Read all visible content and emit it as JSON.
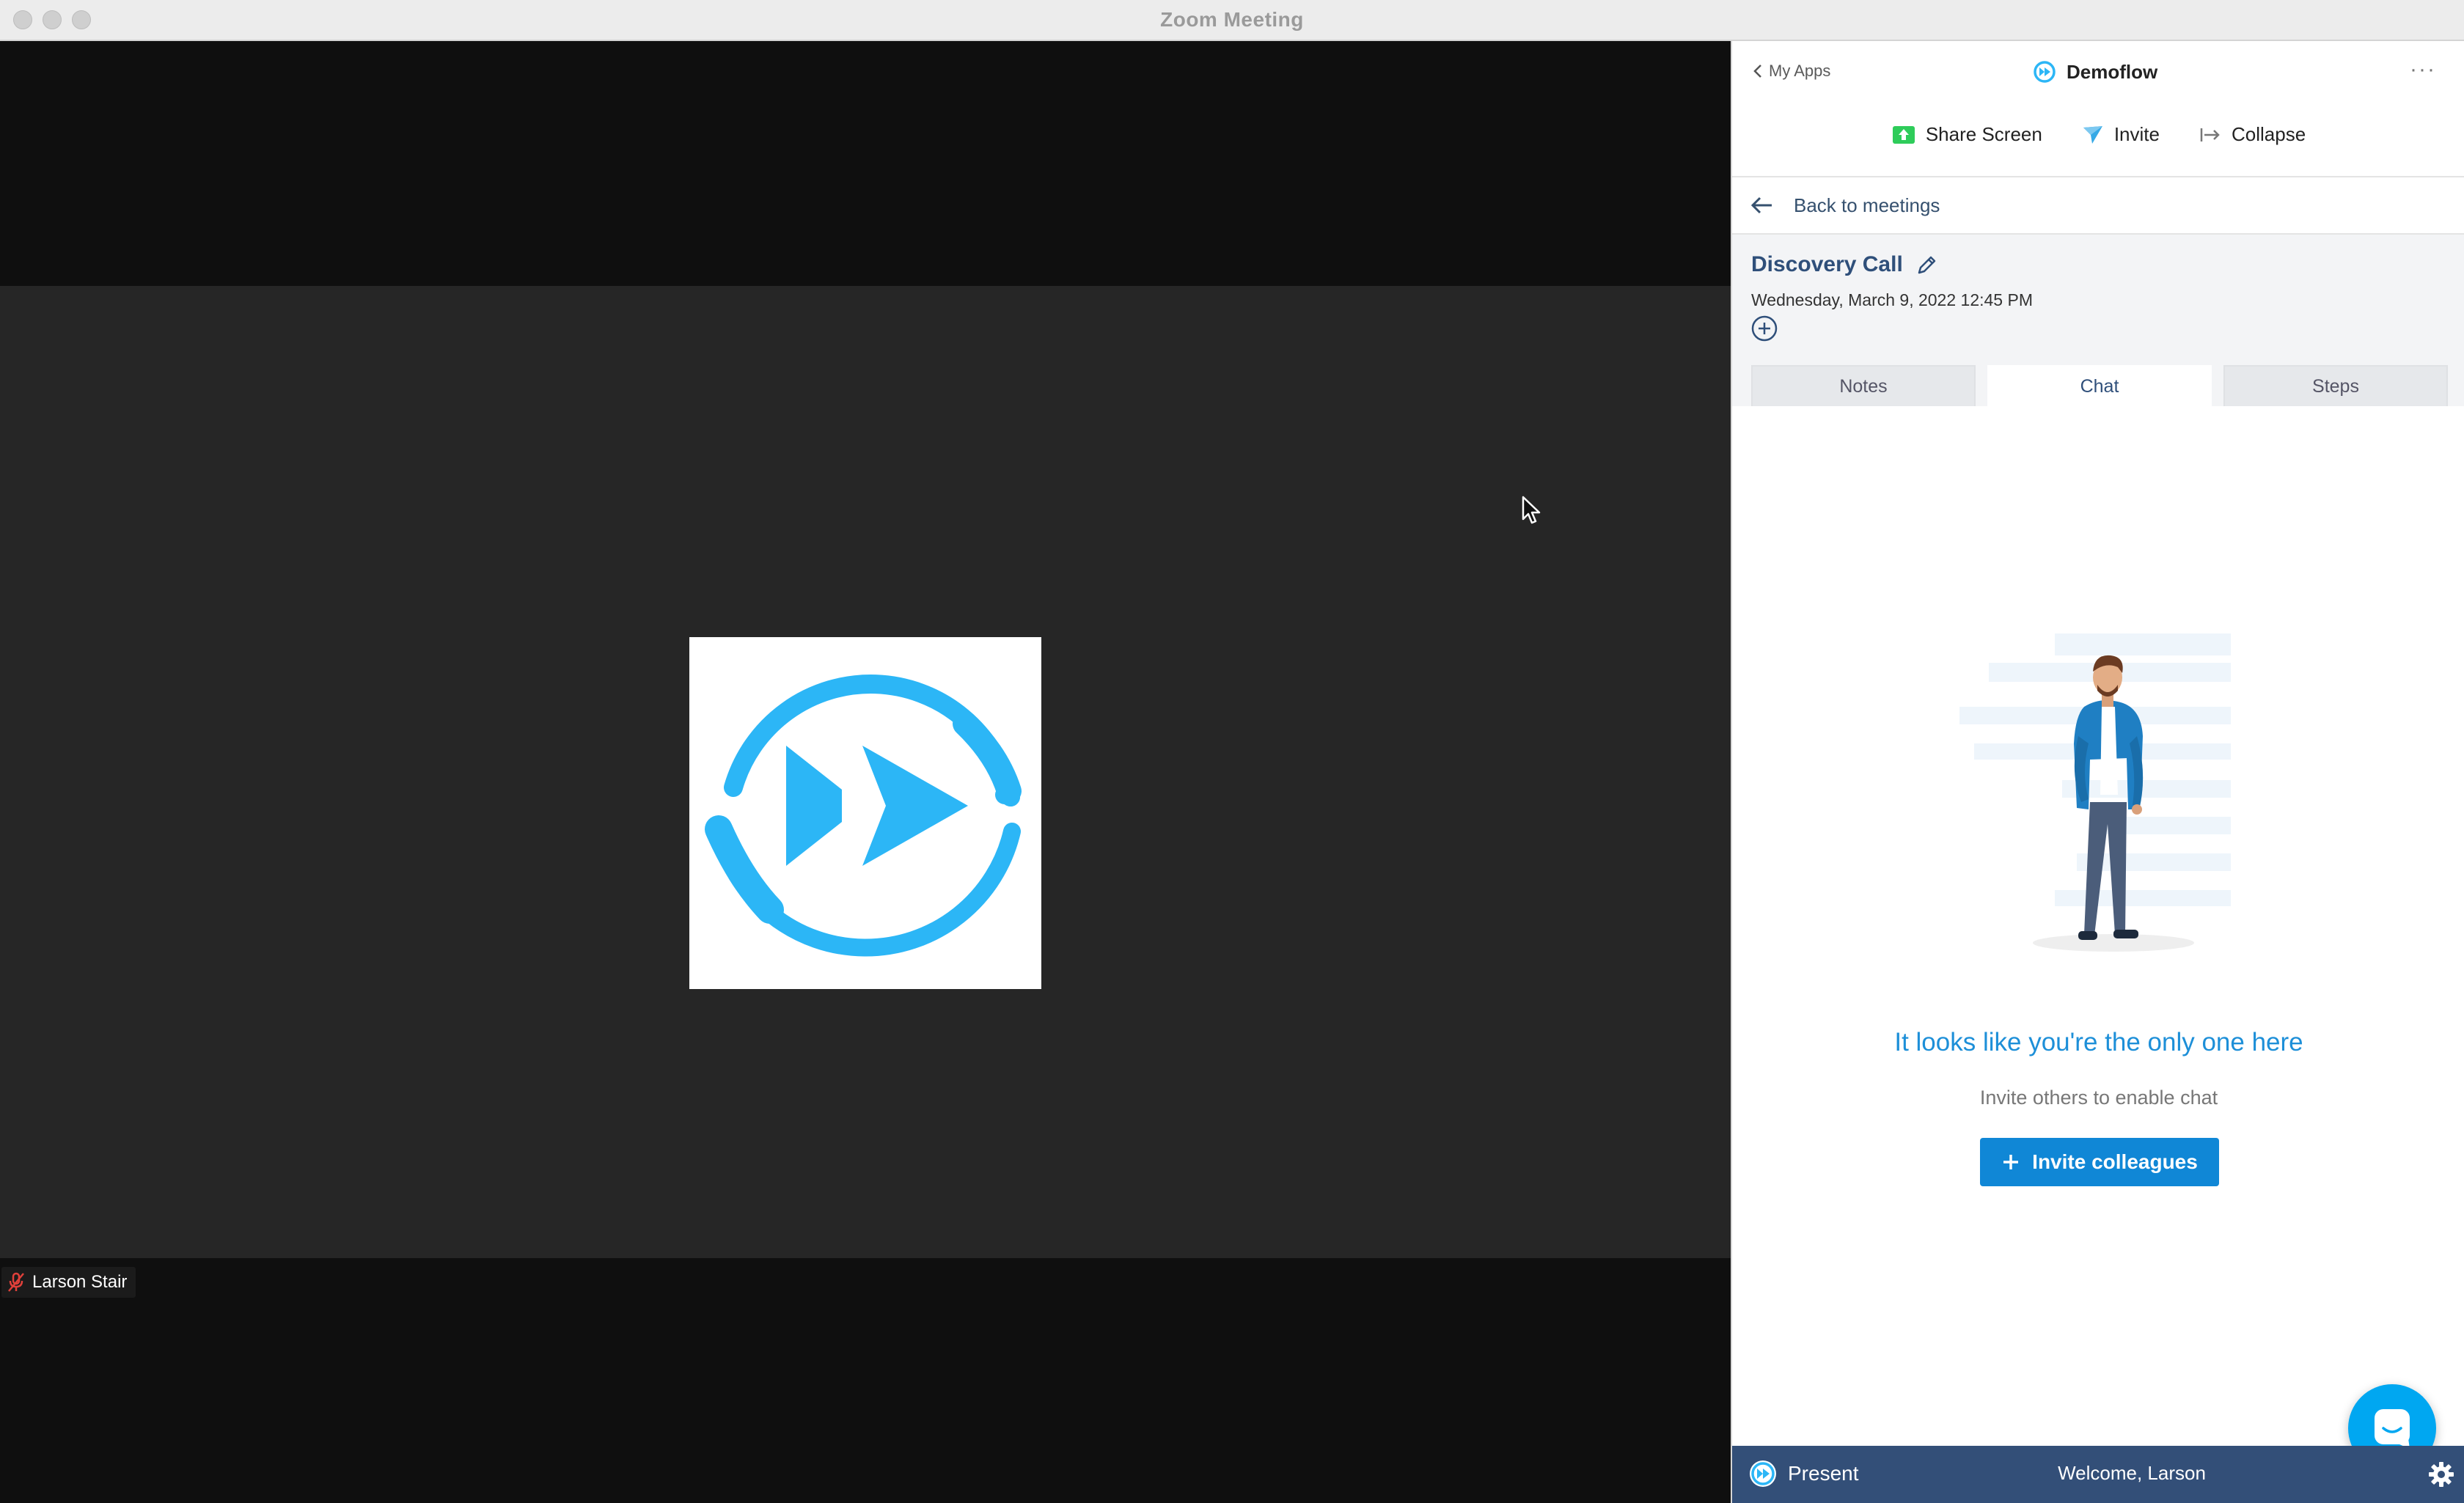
{
  "window": {
    "title": "Zoom Meeting"
  },
  "video": {
    "participant_name": "Larson Stair",
    "muted": true
  },
  "panel": {
    "back_link": "My Apps",
    "app_name": "Demoflow",
    "more_label": "···",
    "toolbar": {
      "share_screen": "Share Screen",
      "invite": "Invite",
      "collapse": "Collapse"
    },
    "back_to_meetings": "Back to meetings",
    "meeting": {
      "title": "Discovery Call",
      "datetime": "Wednesday, March 9, 2022 12:45 PM"
    },
    "tabs": [
      {
        "label": "Notes",
        "active": false
      },
      {
        "label": "Chat",
        "active": true
      },
      {
        "label": "Steps",
        "active": false
      }
    ],
    "chat": {
      "empty_title": "It looks like you're the only one here",
      "empty_subtitle": "Invite others to enable chat",
      "invite_button": "Invite colleagues"
    },
    "footer": {
      "present": "Present",
      "welcome": "Welcome, Larson"
    }
  },
  "colors": {
    "brand_blue": "#2cb6f6",
    "accent_blue": "#1087d6",
    "footer_navy": "#334f78",
    "share_green": "#2ecc5a"
  }
}
